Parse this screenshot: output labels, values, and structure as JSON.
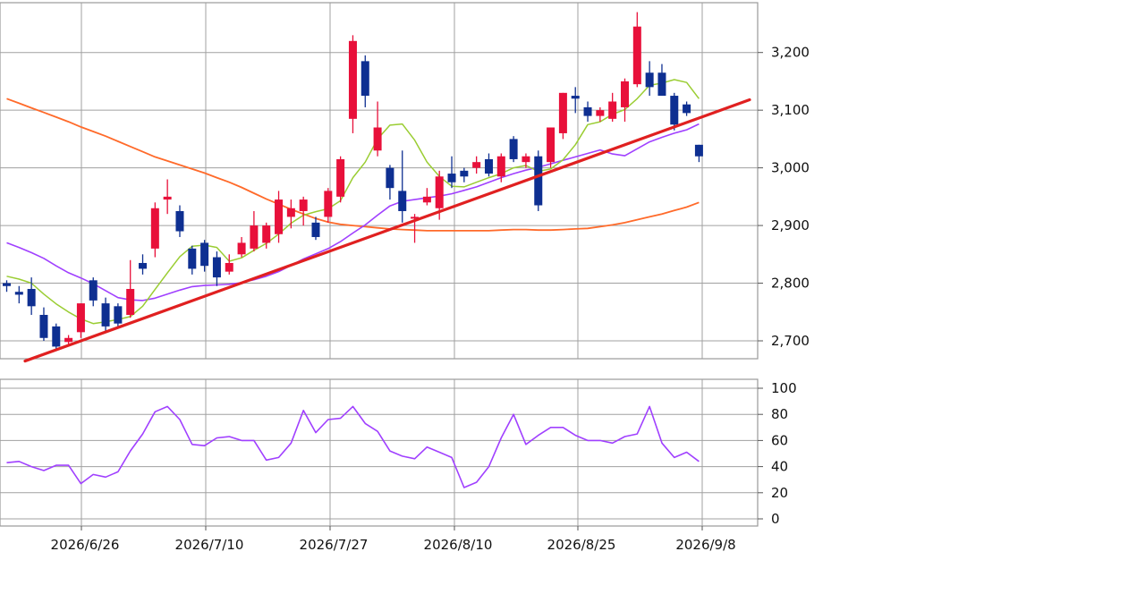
{
  "chart_data": [
    {
      "type": "candlestick",
      "ylim": [
        2670,
        3270
      ],
      "yticks": [
        2700,
        2800,
        2900,
        3000,
        3100,
        3200
      ],
      "yticklabels": [
        "2,700",
        "2,800",
        "2,900",
        "3,000",
        "3,100",
        "3,200"
      ],
      "xticklabels": [
        "2026/6/26",
        "2026/7/10",
        "2026/7/27",
        "2026/8/10",
        "2026/8/25",
        "2026/9/8"
      ],
      "grid": true,
      "colors": {
        "up": "#e8103a",
        "down": "#0e2f91",
        "ma_short": "#9acd32",
        "ma_mid": "#a040ff",
        "ma_long": "#ff6a2a",
        "trendline": "#e02020",
        "grid": "#a0a0a0"
      },
      "candles": [
        [
          2800,
          2805,
          2785,
          2795
        ],
        [
          2785,
          2795,
          2765,
          2780
        ],
        [
          2790,
          2810,
          2745,
          2760
        ],
        [
          2745,
          2758,
          2700,
          2705
        ],
        [
          2725,
          2730,
          2685,
          2690
        ],
        [
          2698,
          2710,
          2694,
          2705
        ],
        [
          2715,
          2765,
          2705,
          2765
        ],
        [
          2805,
          2810,
          2760,
          2770
        ],
        [
          2765,
          2775,
          2715,
          2725
        ],
        [
          2760,
          2765,
          2725,
          2730
        ],
        [
          2745,
          2840,
          2740,
          2790
        ],
        [
          2835,
          2850,
          2815,
          2825
        ],
        [
          2860,
          2940,
          2845,
          2930
        ],
        [
          2945,
          2980,
          2920,
          2950
        ],
        [
          2925,
          2935,
          2880,
          2890
        ],
        [
          2860,
          2865,
          2815,
          2825
        ],
        [
          2870,
          2875,
          2820,
          2830
        ],
        [
          2845,
          2855,
          2795,
          2810
        ],
        [
          2820,
          2850,
          2815,
          2835
        ],
        [
          2850,
          2880,
          2845,
          2870
        ],
        [
          2860,
          2925,
          2855,
          2900
        ],
        [
          2870,
          2905,
          2860,
          2900
        ],
        [
          2885,
          2960,
          2870,
          2945
        ],
        [
          2915,
          2945,
          2895,
          2930
        ],
        [
          2925,
          2950,
          2900,
          2945
        ],
        [
          2905,
          2915,
          2875,
          2880
        ],
        [
          2915,
          2965,
          2905,
          2960
        ],
        [
          2950,
          3020,
          2940,
          3015
        ],
        [
          3085,
          3230,
          3060,
          3220
        ],
        [
          3185,
          3195,
          3105,
          3125
        ],
        [
          3030,
          3115,
          3020,
          3070
        ],
        [
          3000,
          3005,
          2945,
          2965
        ],
        [
          2960,
          3030,
          2905,
          2925
        ],
        [
          2915,
          2920,
          2870,
          2915
        ],
        [
          2940,
          2965,
          2935,
          2950
        ],
        [
          2930,
          2995,
          2910,
          2985
        ],
        [
          2990,
          3020,
          2965,
          2975
        ],
        [
          2995,
          3000,
          2975,
          2985
        ],
        [
          3000,
          3020,
          2990,
          3010
        ],
        [
          3015,
          3025,
          2985,
          2990
        ],
        [
          2985,
          3025,
          2975,
          3020
        ],
        [
          3050,
          3055,
          3010,
          3015
        ],
        [
          3010,
          3025,
          3000,
          3020
        ],
        [
          3020,
          3030,
          2925,
          2935
        ],
        [
          3010,
          3070,
          3000,
          3070
        ],
        [
          3060,
          3130,
          3050,
          3130
        ],
        [
          3125,
          3140,
          3095,
          3120
        ],
        [
          3105,
          3115,
          3080,
          3090
        ],
        [
          3090,
          3105,
          3080,
          3100
        ],
        [
          3085,
          3130,
          3080,
          3115
        ],
        [
          3105,
          3155,
          3080,
          3150
        ],
        [
          3145,
          3270,
          3140,
          3245
        ],
        [
          3165,
          3185,
          3125,
          3140
        ],
        [
          3165,
          3180,
          3125,
          3125
        ],
        [
          3125,
          3130,
          3065,
          3075
        ],
        [
          3110,
          3115,
          3090,
          3095
        ],
        [
          3040,
          3040,
          3010,
          3020
        ]
      ],
      "ma_short": [
        2812,
        2807,
        2800,
        2781,
        2764,
        2750,
        2738,
        2730,
        2733,
        2737,
        2742,
        2760,
        2789,
        2818,
        2846,
        2864,
        2866,
        2862,
        2838,
        2844,
        2857,
        2869,
        2885,
        2904,
        2918,
        2924,
        2929,
        2943,
        2983,
        3010,
        3050,
        3074,
        3076,
        3048,
        3010,
        2985,
        2968,
        2967,
        2975,
        2983,
        2990,
        3000,
        3004,
        2994,
        2998,
        3014,
        3040,
        3075,
        3080,
        3093,
        3101,
        3120,
        3143,
        3147,
        3153,
        3148,
        3120
      ],
      "ma_mid": [
        2870,
        2862,
        2853,
        2843,
        2830,
        2818,
        2809,
        2799,
        2787,
        2775,
        2771,
        2770,
        2774,
        2781,
        2788,
        2794,
        2796,
        2797,
        2798,
        2801,
        2806,
        2812,
        2820,
        2831,
        2842,
        2851,
        2860,
        2872,
        2887,
        2901,
        2918,
        2934,
        2942,
        2945,
        2948,
        2951,
        2955,
        2961,
        2967,
        2975,
        2983,
        2990,
        2996,
        3001,
        3007,
        3013,
        3019,
        3025,
        3031,
        3024,
        3021,
        3033,
        3045,
        3053,
        3060,
        3066,
        3076
      ],
      "ma_long": [
        3120,
        3112,
        3104,
        3096,
        3088,
        3080,
        3071,
        3063,
        3055,
        3046,
        3037,
        3028,
        3019,
        3012,
        3005,
        2998,
        2991,
        2983,
        2975,
        2966,
        2956,
        2946,
        2937,
        2928,
        2920,
        2912,
        2906,
        2902,
        2900,
        2898,
        2896,
        2894,
        2893,
        2892,
        2891,
        2891,
        2891,
        2891,
        2891,
        2891,
        2892,
        2893,
        2893,
        2892,
        2892,
        2893,
        2894,
        2895,
        2898,
        2901,
        2905,
        2910,
        2915,
        2920,
        2926,
        2932,
        2940
      ],
      "trendline": {
        "from": [
          0,
          2665
        ],
        "to": [
          58.5,
          3118
        ]
      }
    },
    {
      "type": "line",
      "ylim": [
        0,
        100
      ],
      "yticks": [
        0,
        20,
        40,
        60,
        80,
        100
      ],
      "yticklabels": [
        "0",
        "20",
        "40",
        "60",
        "80",
        "100"
      ],
      "xticklabels": [
        "2026/6/26",
        "2026/7/10",
        "2026/7/27",
        "2026/8/10",
        "2026/8/25",
        "2026/9/8"
      ],
      "series": [
        {
          "color": "#a040ff",
          "values": [
            43,
            44,
            40,
            37,
            41,
            41,
            27,
            34,
            32,
            36,
            52,
            65,
            82,
            86,
            76,
            57,
            56,
            62,
            63,
            60,
            60,
            45,
            47,
            58,
            83,
            66,
            76,
            77,
            86,
            73,
            67,
            52,
            48,
            46,
            55,
            51,
            47,
            24,
            28,
            40,
            62,
            80,
            57,
            64,
            70,
            70,
            64,
            60,
            60,
            58,
            63,
            65,
            86,
            58,
            47,
            51,
            44
          ]
        }
      ]
    }
  ]
}
